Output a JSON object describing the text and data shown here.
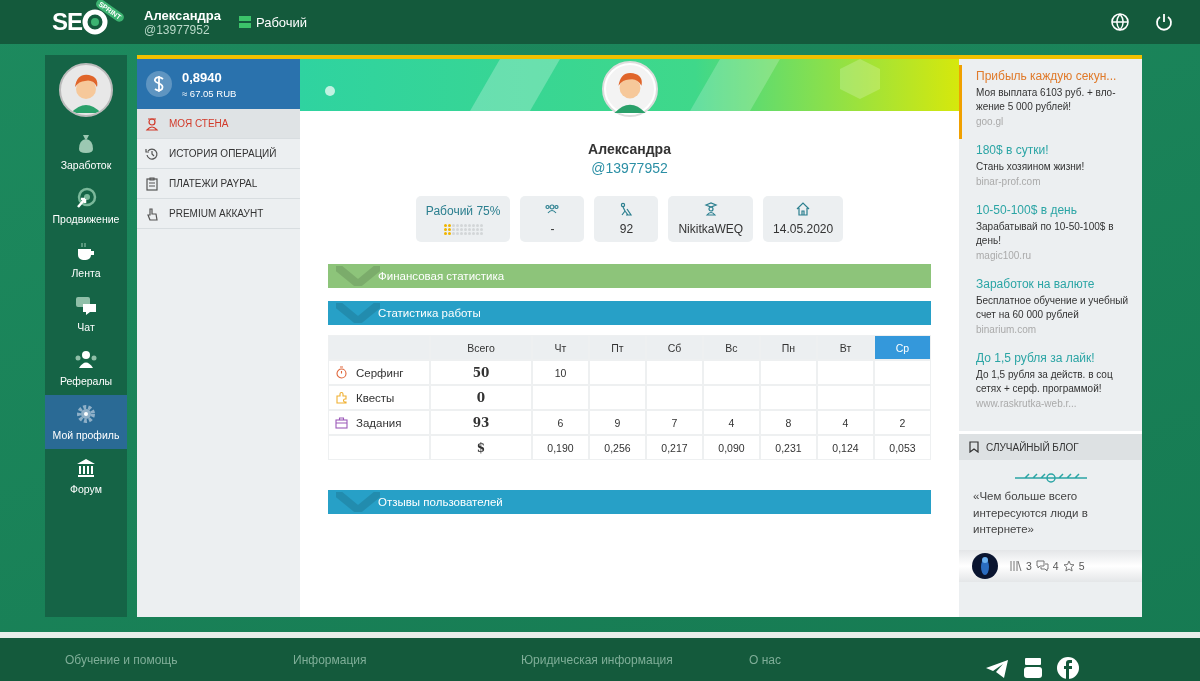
{
  "header": {
    "logo_text": "SE",
    "logo_badge": "SPRINT",
    "user_name": "Александра",
    "user_handle": "@13977952",
    "status": "Рабочий"
  },
  "nav": [
    {
      "label": "Заработок",
      "selected": false
    },
    {
      "label": "Продвижение",
      "selected": false
    },
    {
      "label": "Лента",
      "selected": false
    },
    {
      "label": "Чат",
      "selected": false
    },
    {
      "label": "Рефералы",
      "selected": false
    },
    {
      "label": "Мой профиль",
      "selected": true
    },
    {
      "label": "Форум",
      "selected": false
    }
  ],
  "balance": {
    "amount": "0,8940",
    "converted": "≈ 67.05 RUB"
  },
  "submenu": [
    {
      "label": "МОЯ СТЕНА",
      "selected": true
    },
    {
      "label": "ИСТОРИЯ ОПЕРАЦИЙ",
      "selected": false
    },
    {
      "label": "ПЛАТЕЖИ PAYPAL",
      "selected": false
    },
    {
      "label": "PREMIUM АККАУНТ",
      "selected": false
    }
  ],
  "profile": {
    "name": "Александра",
    "handle": "@13977952"
  },
  "stats": [
    {
      "kind": "status",
      "label": "Рабочий 75%",
      "level": 0.2
    },
    {
      "kind": "referrals",
      "value": "-"
    },
    {
      "kind": "tasks",
      "value": "92"
    },
    {
      "kind": "referrer",
      "value": "NikitkaWEQ"
    },
    {
      "kind": "date",
      "value": "14.05.2020"
    }
  ],
  "sections": [
    {
      "title": "Финансовая статистика",
      "color": "#8dc47a"
    },
    {
      "title": "Статистика работы",
      "color": "#27a0c7",
      "table": {
        "total_header": "Всего",
        "days": [
          {
            "label": "Чт",
            "selected": false
          },
          {
            "label": "Пт",
            "selected": false
          },
          {
            "label": "Сб",
            "selected": false
          },
          {
            "label": "Вс",
            "selected": false
          },
          {
            "label": "Пн",
            "selected": false
          },
          {
            "label": "Вт",
            "selected": false
          },
          {
            "label": "Ср",
            "selected": true
          }
        ],
        "rows": [
          {
            "kind": "surfing",
            "label": "Серфинг",
            "total": "50",
            "values": [
              "10"
            ]
          },
          {
            "kind": "quests",
            "label": "Квесты",
            "total": "0"
          },
          {
            "kind": "tasks",
            "label": "Задания",
            "total": "93",
            "values": [
              "6",
              "9",
              "7",
              "4",
              "8",
              "4",
              "2"
            ]
          },
          {
            "kind": "money",
            "total": "$",
            "values": [
              "0,190",
              "0,256",
              "0,217",
              "0,090",
              "0,231",
              "0,124",
              "0,053"
            ]
          }
        ]
      }
    },
    {
      "title": "Отзывы пользователей",
      "color": "#27a0c7"
    }
  ],
  "ads": [
    {
      "title": "Прибыль каждую секун...",
      "text": "Моя выплата 6103 руб. + вло-жение 5 000 рублей!",
      "url": "goo.gl",
      "highlighted": true
    },
    {
      "title": "180$ в сутки!",
      "text": "Стань хозяином жизни!",
      "url": "binar-prof.com",
      "highlighted": false
    },
    {
      "title": "10-50-100$ в день",
      "text": "Зарабатывай по 10-50-100$ в день!",
      "url": "magic100.ru",
      "highlighted": false
    },
    {
      "title": "Заработок на валюте",
      "text": "Бесплатное обучение и учебный счет на 60 000 рублей",
      "url": "binarium.com",
      "highlighted": false
    },
    {
      "title": "До 1,5 рубля за лайк!",
      "text": "До 1,5 рубля за действ. в соц сетях + серф. программой!",
      "url": "www.raskrutka-web.r...",
      "highlighted": false
    }
  ],
  "blog": {
    "heading": "СЛУЧАЙНЫЙ БЛОГ",
    "quote": "«Чем больше всего интересуются люди в интернете»",
    "posts": "3",
    "comments": "4",
    "stars_count": "5"
  },
  "footer": {
    "links": [
      "Обучение и помощь",
      "Информация",
      "Юридическая информация",
      "О нас"
    ]
  }
}
